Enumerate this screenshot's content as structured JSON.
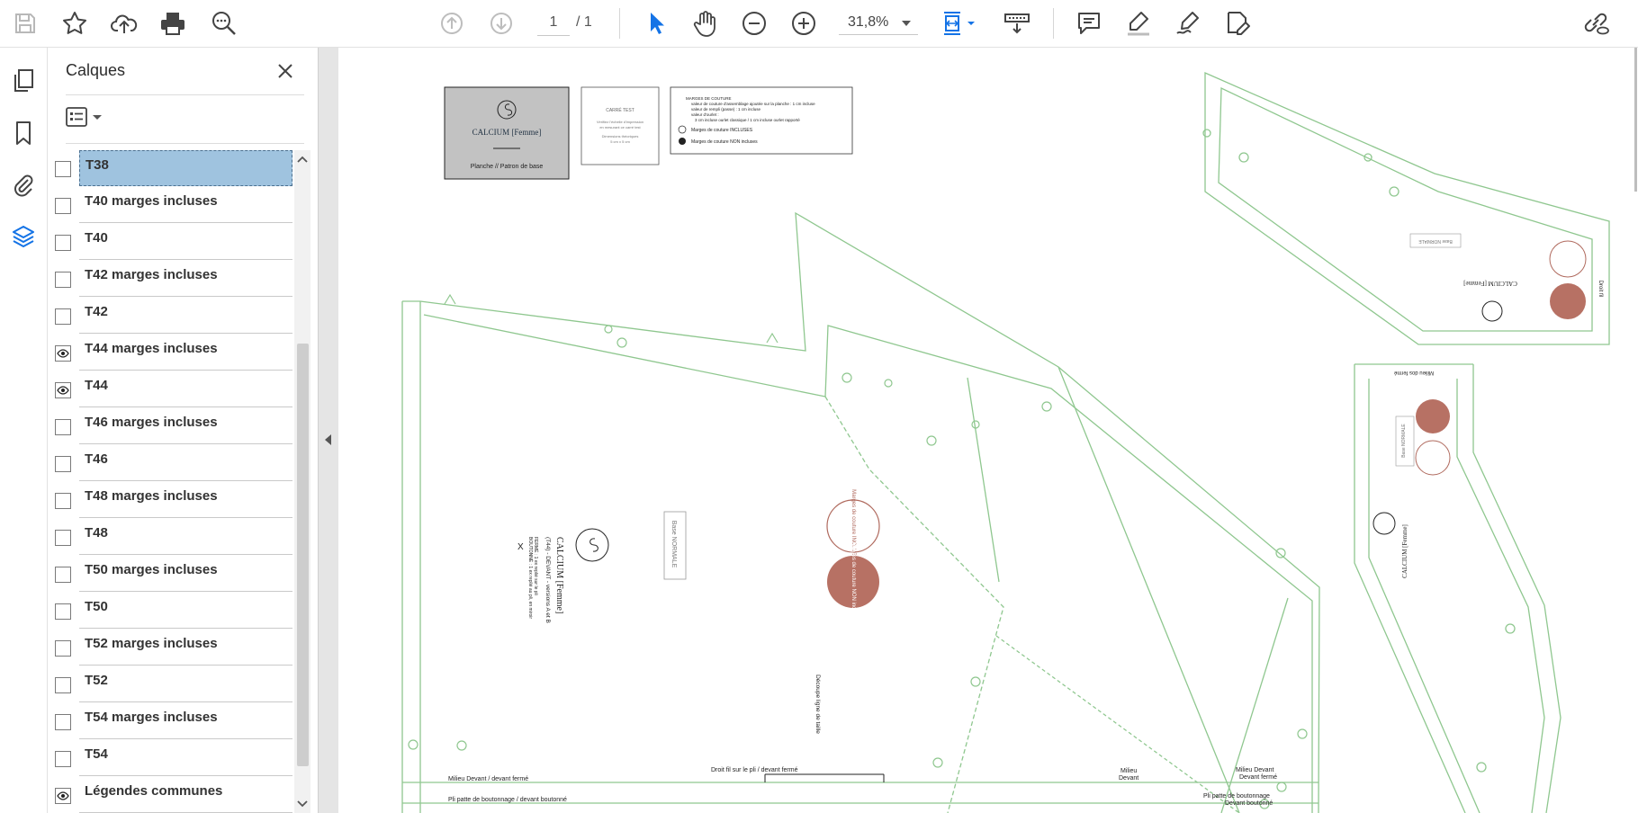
{
  "toolbar": {
    "page_current": "1",
    "page_total": "/  1",
    "zoom": "31,8%"
  },
  "layers_panel": {
    "title": "Calques",
    "layers": [
      {
        "label": "T38",
        "visible": false,
        "selected": true
      },
      {
        "label": "T40 marges incluses",
        "visible": false
      },
      {
        "label": "T40",
        "visible": false
      },
      {
        "label": "T42 marges incluses",
        "visible": false
      },
      {
        "label": "T42",
        "visible": false
      },
      {
        "label": "T44 marges incluses",
        "visible": true
      },
      {
        "label": "T44",
        "visible": true
      },
      {
        "label": "T46 marges incluses",
        "visible": false
      },
      {
        "label": "T46",
        "visible": false
      },
      {
        "label": "T48 marges incluses",
        "visible": false
      },
      {
        "label": "T48",
        "visible": false
      },
      {
        "label": "T50 marges incluses",
        "visible": false
      },
      {
        "label": "T50",
        "visible": false
      },
      {
        "label": "T52 marges incluses",
        "visible": false
      },
      {
        "label": "T52",
        "visible": false
      },
      {
        "label": "T54 marges incluses",
        "visible": false
      },
      {
        "label": "T54",
        "visible": false
      },
      {
        "label": "Légendes communes",
        "visible": true
      }
    ]
  },
  "document": {
    "brand_box": {
      "brand": "CALCIUM [Femme]",
      "subtitle": "Planche // Patron de base"
    },
    "test_square": {
      "title": "CARRÉ TEST",
      "line1": "Vérifiez l'échelle d'impression",
      "line2": "en mesurant ce carré test",
      "line3": "Dimensions théoriques",
      "line4": "5 cm x 5 cm"
    },
    "legend_box": {
      "heading": "MARGES DE COUTURE",
      "b1": "valeur de couture d'assemblage ajoutée sur la planche : 1 cm incluse",
      "b2": "valeur de rempli (passe) : 1 cm incluse",
      "b3": "valeur d'ourlet :",
      "b4": "3 cm incluse ourlet classique / 1 cm incluse ourlet rapporté",
      "l1": "Marges de couture INCLUSES",
      "l2": "Marges de couture NON incluses"
    },
    "front_piece": {
      "brand": "CALCIUM [Femme]",
      "piece": "(T44) - DEVANT - versions A et B",
      "note": "FERMÉ : 1 ex replié sur le pli",
      "note2": "BOUTONNÉ : 1 ex replié au pli, en miroir",
      "base_label": "Base NORMALE",
      "waist_label": "Découpe ligne de taille",
      "bottom_label1": "Milieu Devant / devant fermé",
      "bottom_label2": "Pli patte de boutonnage / devant boutonné",
      "grain_label": "Droit fil sur le pli / devant fermé",
      "milieu": "Milieu",
      "devant": "Devant",
      "milieu_devant": "Milieu Devant",
      "devant_ferme": "Devant fermé",
      "pli_patte": "Pli patte de boutonnage",
      "devant_boutonne": "Devant boutonné"
    },
    "circles": {
      "included": "Marges de couture INCLUSES",
      "not_included": "Marges de couture NON incluses"
    },
    "right_piece": {
      "base_label": "Base NORMALE",
      "brand": "CALCIUM [Femme]",
      "grain": "Droit fil",
      "milieu_dos": "Milieu dos fermé"
    }
  }
}
